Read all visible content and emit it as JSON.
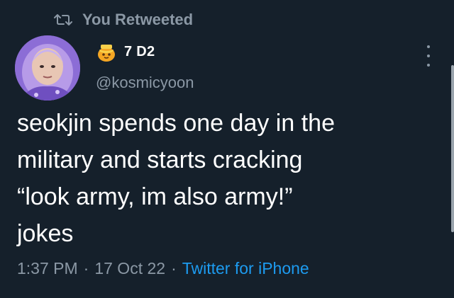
{
  "retweet_banner": {
    "icon": "retweet-icon",
    "label": "You Retweeted"
  },
  "author": {
    "avatar": "avatar",
    "emoji": "honey-pot-emoji",
    "display_name": "7 D2",
    "handle": "@kosmicyoon"
  },
  "menu": {
    "icon": "more-options-icon"
  },
  "tweet": {
    "lines": [
      "seokjin spends one day in the",
      "military and starts cracking",
      "“look army, im also army!”",
      "jokes"
    ],
    "time": "1:37 PM",
    "date": "17 Oct 22",
    "separator": "·",
    "source": "Twitter for iPhone"
  },
  "colors": {
    "background": "#15202b",
    "secondary_text": "#8b98a5",
    "link": "#1d9bf0",
    "primary_text": "#ffffff"
  }
}
